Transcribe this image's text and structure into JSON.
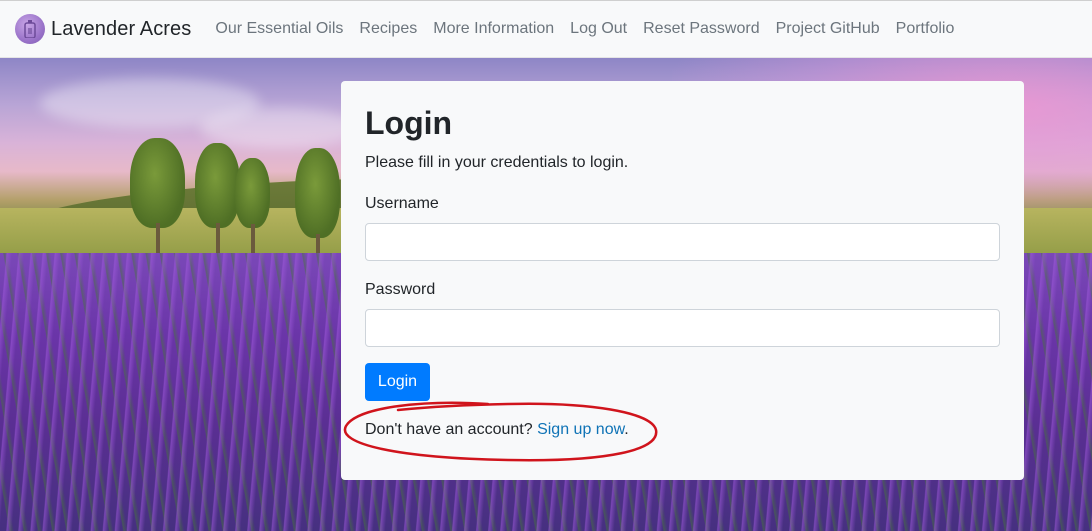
{
  "navbar": {
    "brand_name": "Lavender Acres",
    "brand_logo": "lavender-bottle-icon",
    "links": [
      {
        "label": "Our Essential Oils"
      },
      {
        "label": "Recipes"
      },
      {
        "label": "More Information"
      },
      {
        "label": "Log Out"
      },
      {
        "label": "Reset Password"
      },
      {
        "label": "Project GitHub"
      },
      {
        "label": "Portfolio"
      }
    ]
  },
  "login": {
    "title": "Login",
    "subtitle": "Please fill in your credentials to login.",
    "username_label": "Username",
    "username_value": "",
    "password_label": "Password",
    "password_value": "",
    "submit_label": "Login",
    "signup_prompt": "Don't have an account?",
    "signup_link": "Sign up now",
    "signup_suffix": "."
  },
  "colors": {
    "primary": "#007bff",
    "link": "#0f73b6",
    "navbar_bg": "#f8f9fa",
    "annotation": "#d0141c"
  }
}
